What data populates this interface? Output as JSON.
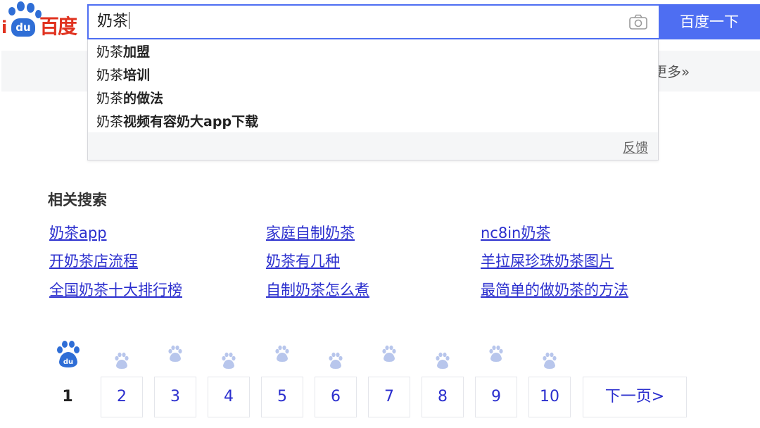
{
  "header": {
    "logo_prefix": "i",
    "logo_du": "du",
    "logo_brand": "百度",
    "search_value": "奶茶",
    "search_button_label": "百度一下",
    "more_label": "更多»"
  },
  "suggestions": {
    "items": [
      {
        "prefix": "奶茶",
        "rest": "加盟"
      },
      {
        "prefix": "奶茶",
        "rest": "培训"
      },
      {
        "prefix": "奶茶",
        "rest": "的做法"
      },
      {
        "prefix": "奶茶",
        "rest": "视频有容奶大app下载"
      }
    ],
    "feedback_label": "反馈"
  },
  "related": {
    "title": "相关搜索",
    "links": [
      "奶茶app",
      "家庭自制奶茶",
      "nc8in奶茶",
      "开奶茶店流程",
      "奶茶有几种",
      "羊拉屎珍珠奶茶图片",
      "全国奶茶十大排行榜",
      "自制奶茶怎么煮",
      "最简单的做奶茶的方法"
    ]
  },
  "pagination": {
    "current": "1",
    "pages": [
      "2",
      "3",
      "4",
      "5",
      "6",
      "7",
      "8",
      "9",
      "10"
    ],
    "next_label": "下一页>"
  },
  "colors": {
    "accent": "#4e6ef2",
    "link": "#2b2fce",
    "brand_red": "#e0321f",
    "paw_blue": "#2f6ed6"
  }
}
